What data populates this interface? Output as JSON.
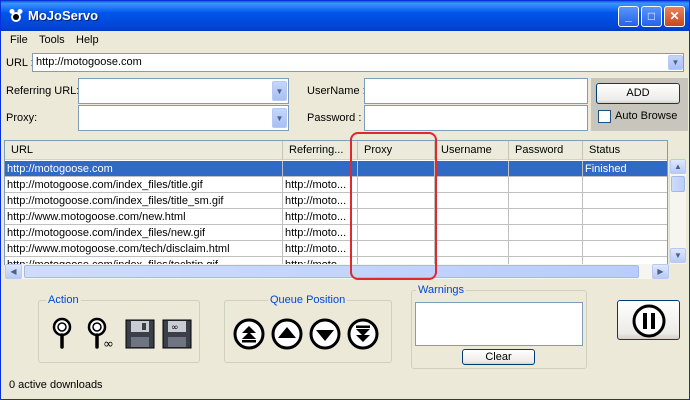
{
  "window": {
    "title": "MoJoServo"
  },
  "title_buttons": {
    "minimize": "_",
    "maximize": "□",
    "close": "✕"
  },
  "menu": {
    "items": [
      "File",
      "Tools",
      "Help"
    ]
  },
  "url_field": {
    "label": "URL :",
    "value": "http://motogoose.com"
  },
  "referring_field": {
    "label": "Referring URL:",
    "value": ""
  },
  "proxy_field": {
    "label": "Proxy:",
    "value": ""
  },
  "username_field": {
    "label": "UserName :",
    "value": ""
  },
  "password_field": {
    "label": "Password :",
    "value": ""
  },
  "add_button": {
    "label": "ADD"
  },
  "auto_browse": {
    "label": "Auto Browse",
    "checked": false
  },
  "table": {
    "columns": [
      "URL",
      "Referring...",
      "Proxy",
      "Username",
      "Password",
      "Status"
    ],
    "rows": [
      [
        "http://motogoose.com",
        "",
        "",
        "",
        "",
        "Finished"
      ],
      [
        "http://motogoose.com/index_files/title.gif",
        "http://moto...",
        "",
        "",
        "",
        ""
      ],
      [
        "http://motogoose.com/index_files/title_sm.gif",
        "http://moto...",
        "",
        "",
        "",
        ""
      ],
      [
        "http://www.motogoose.com/new.html",
        "http://moto...",
        "",
        "",
        "",
        ""
      ],
      [
        "http://motogoose.com/index_files/new.gif",
        "http://moto...",
        "",
        "",
        "",
        ""
      ],
      [
        "http://www.motogoose.com/tech/disclaim.html",
        "http://moto...",
        "",
        "",
        "",
        ""
      ],
      [
        "http://motogoose.com/index_files/techtip.gif",
        "http://moto...",
        "",
        "",
        "",
        ""
      ]
    ],
    "selected_row": 0
  },
  "action_group": {
    "title": "Action",
    "icons": [
      "search-icon",
      "search-all-icon",
      "save-icon",
      "save-all-icon"
    ]
  },
  "queue_group": {
    "title": "Queue Position",
    "icons": [
      "move-top-icon",
      "move-up-icon",
      "move-down-icon",
      "move-bottom-icon"
    ]
  },
  "warnings_group": {
    "title": "Warnings",
    "text": ""
  },
  "clear_button": {
    "label": "Clear"
  },
  "pause_button": {
    "icon": "pause-icon"
  },
  "status": {
    "text": "0 active downloads"
  },
  "colors": {
    "selection": "#316ac5",
    "highlight": "#e0282e",
    "titlebar": "#0055ea"
  }
}
